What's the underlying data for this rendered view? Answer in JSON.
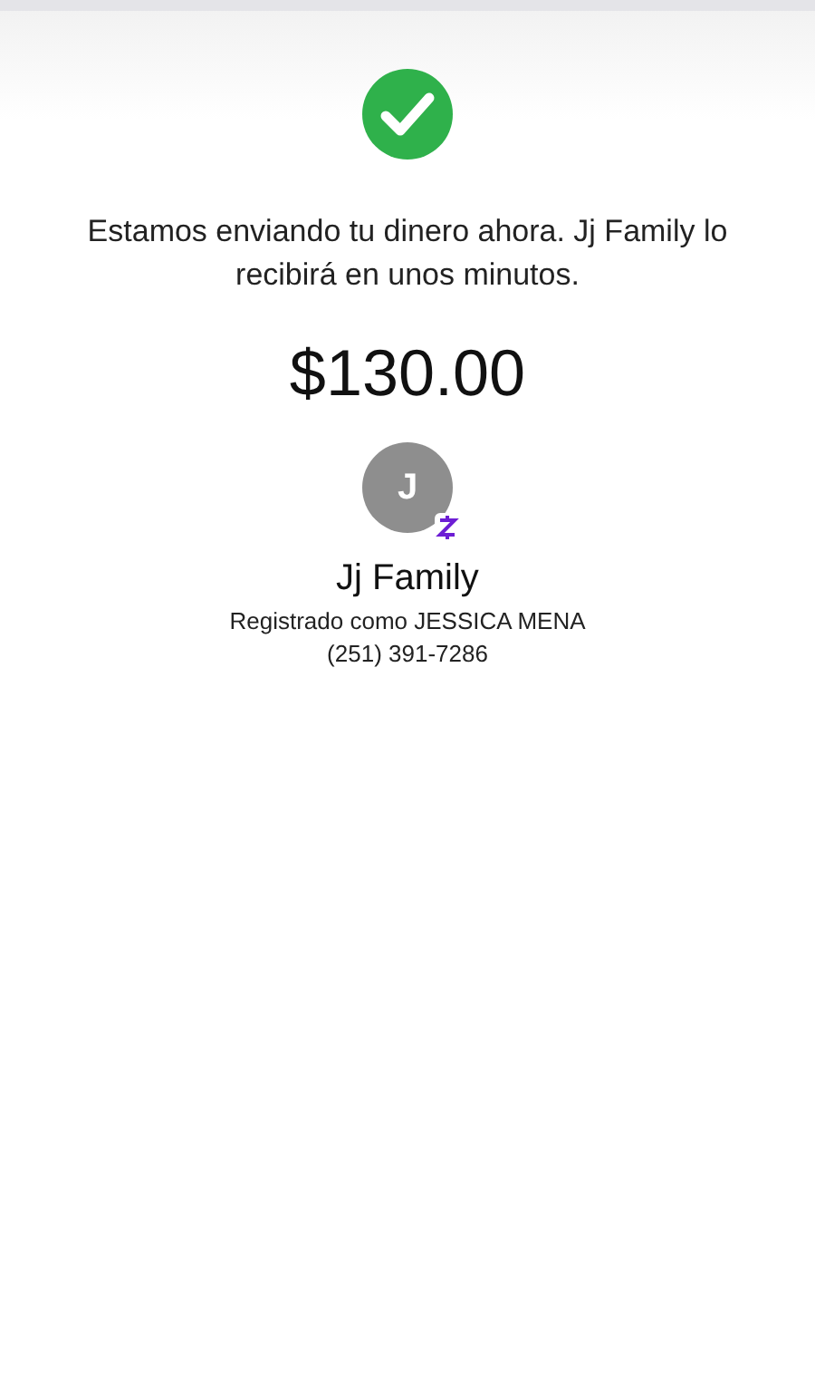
{
  "message": "Estamos enviando tu dinero ahora. Jj Family lo recibirá en unos minutos.",
  "amount": "$130.00",
  "recipient": {
    "initial": "J",
    "name": "Jj Family",
    "registered_as": "Registrado como JESSICA MENA",
    "phone": "(251) 391-7286"
  }
}
